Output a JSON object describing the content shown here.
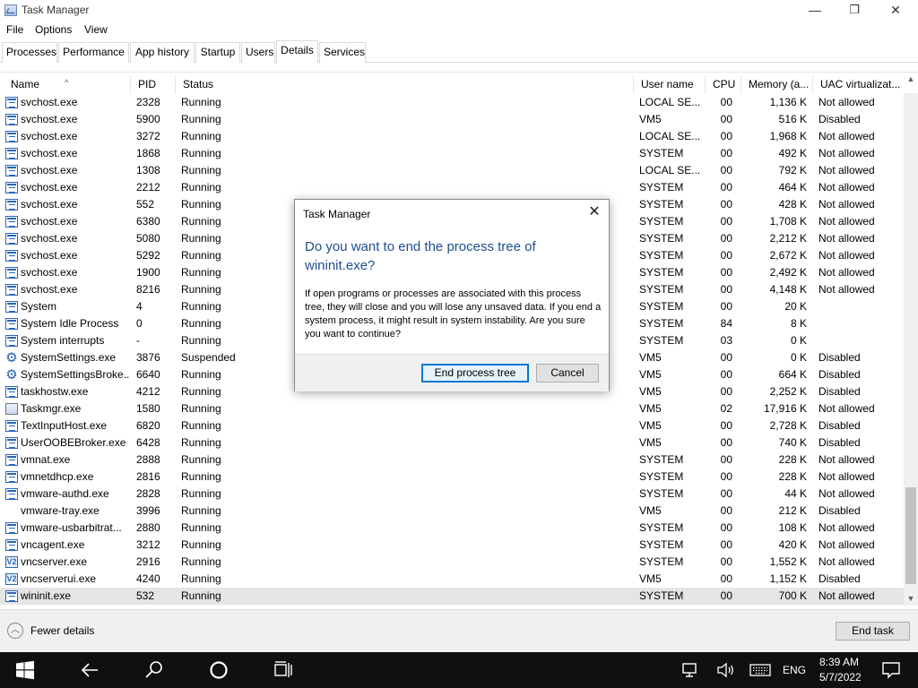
{
  "window": {
    "title": "Task Manager",
    "minimize_glyph": "—",
    "restore_glyph": "❐",
    "close_glyph": "✕"
  },
  "menu": [
    "File",
    "Options",
    "View"
  ],
  "tabs": [
    {
      "label": "Processes",
      "active": false
    },
    {
      "label": "Performance",
      "active": false
    },
    {
      "label": "App history",
      "active": false
    },
    {
      "label": "Startup",
      "active": false
    },
    {
      "label": "Users",
      "active": false
    },
    {
      "label": "Details",
      "active": true
    },
    {
      "label": "Services",
      "active": false
    }
  ],
  "columns": [
    "Name",
    "PID",
    "Status",
    "User name",
    "CPU",
    "Memory (a...",
    "UAC virtualizat..."
  ],
  "rows": [
    {
      "name": "svchost.exe",
      "pid": "2328",
      "status": "Running",
      "user": "LOCAL SE...",
      "cpu": "00",
      "mem": "1,136 K",
      "uac": "Not allowed",
      "icon": "service-icon"
    },
    {
      "name": "svchost.exe",
      "pid": "5900",
      "status": "Running",
      "user": "VM5",
      "cpu": "00",
      "mem": "516 K",
      "uac": "Disabled",
      "icon": "service-icon"
    },
    {
      "name": "svchost.exe",
      "pid": "3272",
      "status": "Running",
      "user": "LOCAL SE...",
      "cpu": "00",
      "mem": "1,968 K",
      "uac": "Not allowed",
      "icon": "service-icon"
    },
    {
      "name": "svchost.exe",
      "pid": "1868",
      "status": "Running",
      "user": "SYSTEM",
      "cpu": "00",
      "mem": "492 K",
      "uac": "Not allowed",
      "icon": "service-icon"
    },
    {
      "name": "svchost.exe",
      "pid": "1308",
      "status": "Running",
      "user": "LOCAL SE...",
      "cpu": "00",
      "mem": "792 K",
      "uac": "Not allowed",
      "icon": "service-icon"
    },
    {
      "name": "svchost.exe",
      "pid": "2212",
      "status": "Running",
      "user": "SYSTEM",
      "cpu": "00",
      "mem": "464 K",
      "uac": "Not allowed",
      "icon": "service-icon"
    },
    {
      "name": "svchost.exe",
      "pid": "552",
      "status": "Running",
      "user": "SYSTEM",
      "cpu": "00",
      "mem": "428 K",
      "uac": "Not allowed",
      "icon": "service-icon"
    },
    {
      "name": "svchost.exe",
      "pid": "6380",
      "status": "Running",
      "user": "SYSTEM",
      "cpu": "00",
      "mem": "1,708 K",
      "uac": "Not allowed",
      "icon": "service-icon"
    },
    {
      "name": "svchost.exe",
      "pid": "5080",
      "status": "Running",
      "user": "SYSTEM",
      "cpu": "00",
      "mem": "2,212 K",
      "uac": "Not allowed",
      "icon": "service-icon"
    },
    {
      "name": "svchost.exe",
      "pid": "5292",
      "status": "Running",
      "user": "SYSTEM",
      "cpu": "00",
      "mem": "2,672 K",
      "uac": "Not allowed",
      "icon": "service-icon"
    },
    {
      "name": "svchost.exe",
      "pid": "1900",
      "status": "Running",
      "user": "SYSTEM",
      "cpu": "00",
      "mem": "2,492 K",
      "uac": "Not allowed",
      "icon": "service-icon"
    },
    {
      "name": "svchost.exe",
      "pid": "8216",
      "status": "Running",
      "user": "SYSTEM",
      "cpu": "00",
      "mem": "4,148 K",
      "uac": "Not allowed",
      "icon": "service-icon"
    },
    {
      "name": "System",
      "pid": "4",
      "status": "Running",
      "user": "SYSTEM",
      "cpu": "00",
      "mem": "20 K",
      "uac": "",
      "icon": "service-icon"
    },
    {
      "name": "System Idle Process",
      "pid": "0",
      "status": "Running",
      "user": "SYSTEM",
      "cpu": "84",
      "mem": "8 K",
      "uac": "",
      "icon": "service-icon"
    },
    {
      "name": "System interrupts",
      "pid": "-",
      "status": "Running",
      "user": "SYSTEM",
      "cpu": "03",
      "mem": "0 K",
      "uac": "",
      "icon": "service-icon"
    },
    {
      "name": "SystemSettings.exe",
      "pid": "3876",
      "status": "Suspended",
      "user": "VM5",
      "cpu": "00",
      "mem": "0 K",
      "uac": "Disabled",
      "icon": "gear-icon"
    },
    {
      "name": "SystemSettingsBroke...",
      "pid": "6640",
      "status": "Running",
      "user": "VM5",
      "cpu": "00",
      "mem": "664 K",
      "uac": "Disabled",
      "icon": "gear-icon"
    },
    {
      "name": "taskhostw.exe",
      "pid": "4212",
      "status": "Running",
      "user": "VM5",
      "cpu": "00",
      "mem": "2,252 K",
      "uac": "Disabled",
      "icon": "service-icon"
    },
    {
      "name": "Taskmgr.exe",
      "pid": "1580",
      "status": "Running",
      "user": "VM5",
      "cpu": "02",
      "mem": "17,916 K",
      "uac": "Not allowed",
      "icon": "task-manager-icon"
    },
    {
      "name": "TextInputHost.exe",
      "pid": "6820",
      "status": "Running",
      "user": "VM5",
      "cpu": "00",
      "mem": "2,728 K",
      "uac": "Disabled",
      "icon": "service-icon"
    },
    {
      "name": "UserOOBEBroker.exe",
      "pid": "6428",
      "status": "Running",
      "user": "VM5",
      "cpu": "00",
      "mem": "740 K",
      "uac": "Disabled",
      "icon": "service-icon"
    },
    {
      "name": "vmnat.exe",
      "pid": "2888",
      "status": "Running",
      "user": "SYSTEM",
      "cpu": "00",
      "mem": "228 K",
      "uac": "Not allowed",
      "icon": "service-icon"
    },
    {
      "name": "vmnetdhcp.exe",
      "pid": "2816",
      "status": "Running",
      "user": "SYSTEM",
      "cpu": "00",
      "mem": "228 K",
      "uac": "Not allowed",
      "icon": "service-icon"
    },
    {
      "name": "vmware-authd.exe",
      "pid": "2828",
      "status": "Running",
      "user": "SYSTEM",
      "cpu": "00",
      "mem": "44 K",
      "uac": "Not allowed",
      "icon": "service-icon"
    },
    {
      "name": "vmware-tray.exe",
      "pid": "3996",
      "status": "Running",
      "user": "VM5",
      "cpu": "00",
      "mem": "212 K",
      "uac": "Disabled",
      "icon": ""
    },
    {
      "name": "vmware-usbarbitrat...",
      "pid": "2880",
      "status": "Running",
      "user": "SYSTEM",
      "cpu": "00",
      "mem": "108 K",
      "uac": "Not allowed",
      "icon": "service-icon"
    },
    {
      "name": "vncagent.exe",
      "pid": "3212",
      "status": "Running",
      "user": "SYSTEM",
      "cpu": "00",
      "mem": "420 K",
      "uac": "Not allowed",
      "icon": "service-icon"
    },
    {
      "name": "vncserver.exe",
      "pid": "2916",
      "status": "Running",
      "user": "SYSTEM",
      "cpu": "00",
      "mem": "1,552 K",
      "uac": "Not allowed",
      "icon": "vnc-icon"
    },
    {
      "name": "vncserverui.exe",
      "pid": "4240",
      "status": "Running",
      "user": "VM5",
      "cpu": "00",
      "mem": "1,152 K",
      "uac": "Disabled",
      "icon": "vnc-icon"
    },
    {
      "name": "wininit.exe",
      "pid": "532",
      "status": "Running",
      "user": "SYSTEM",
      "cpu": "00",
      "mem": "700 K",
      "uac": "Not allowed",
      "icon": "service-icon",
      "selected": true
    }
  ],
  "vnc_glyph": "V2",
  "footer": {
    "fewer_details_label": "Fewer details",
    "end_task_label": "End task"
  },
  "dialog": {
    "title": "Task Manager",
    "close_glyph": "✕",
    "heading": "Do you want to end the process tree of wininit.exe?",
    "body": "If open programs or processes are associated with this process tree, they will close and you will lose any unsaved data. If you end a system process, it might result in system instability. Are you sure you want to continue?",
    "primary_label": "End process tree",
    "cancel_label": "Cancel"
  },
  "taskbar": {
    "language": "ENG",
    "time": "8:39 AM",
    "date": "5/7/2022"
  }
}
